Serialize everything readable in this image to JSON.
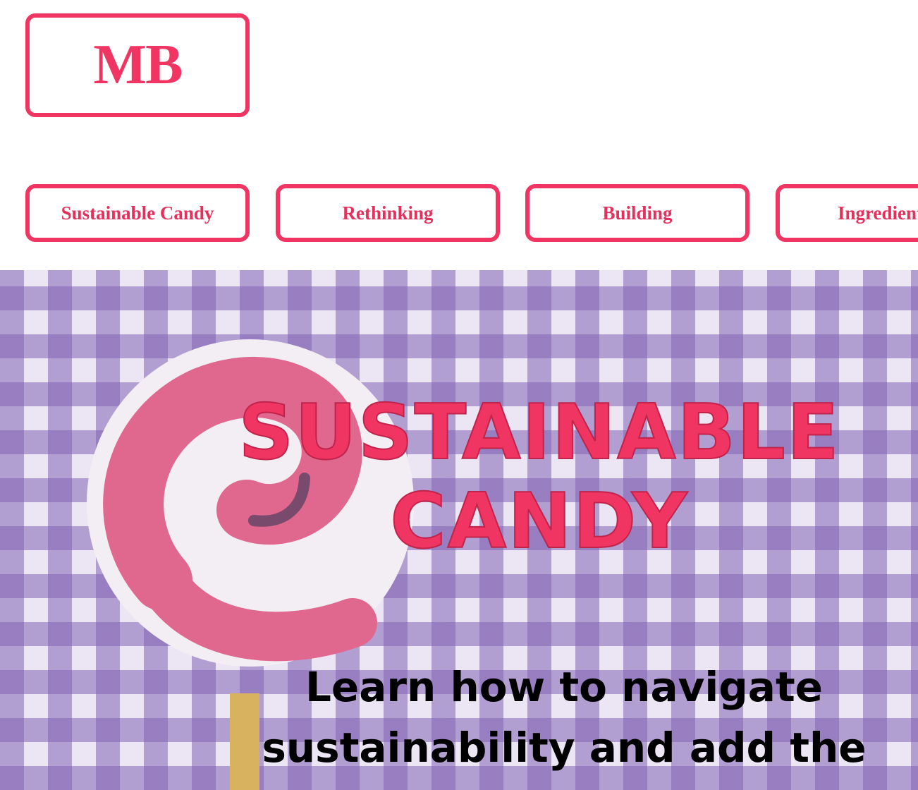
{
  "logo": {
    "text": "MB"
  },
  "nav": {
    "items": [
      {
        "label": "Sustainable Candy"
      },
      {
        "label": "Rethinking"
      },
      {
        "label": "Building"
      },
      {
        "label": "Ingredients"
      }
    ]
  },
  "hero": {
    "title": "Sustainable Candy",
    "text": "Learn how to navigate sustainability and add the"
  },
  "colors": {
    "accent": "#f03562",
    "hero_background": "#b9a9d6",
    "lollipop_pink": "#e0678e",
    "lollipop_stick": "#d9b25f"
  }
}
